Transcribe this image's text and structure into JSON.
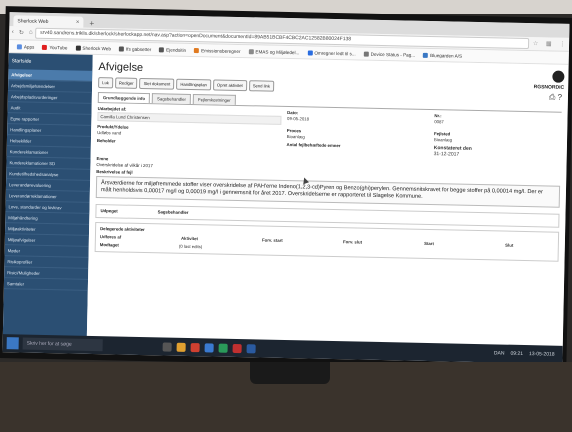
{
  "browser": {
    "tab_title": "Sherlock Web",
    "url": "srv40.sandrens.triklis.dk/sherlock/sherlockapp.net/nav.asp?action=openDocument&documentId=89AB51BCBF4CBC2AC12582B80024F138",
    "bookmarks": [
      {
        "label": "Apps",
        "color": "#5a8de0"
      },
      {
        "label": "YouTube",
        "color": "#e02020"
      },
      {
        "label": "Sherlock Web",
        "color": "#333333"
      },
      {
        "label": "Ifs gabsetter",
        "color": "#555555"
      },
      {
        "label": "Ejendsitin",
        "color": "#555555"
      },
      {
        "label": "Emissionsberegner",
        "color": "#e07a20"
      },
      {
        "label": "EMAS og Miljøledel...",
        "color": "#8a8a8a"
      },
      {
        "label": "Omregner ledt til s...",
        "color": "#2a6de0"
      },
      {
        "label": "Device Status - Pag...",
        "color": "#777777"
      },
      {
        "label": "Bluegarden A/S",
        "color": "#3a78c4"
      }
    ]
  },
  "sidebar": {
    "header": "Startside",
    "items": [
      {
        "label": "Afvigelser",
        "active": true
      },
      {
        "label": "Arbejdsmiljøhændelser",
        "active": false
      },
      {
        "label": "Arbejdspladsvurderinger",
        "active": false
      },
      {
        "label": "Audit",
        "active": false
      },
      {
        "label": "Egne rapporter",
        "active": false
      },
      {
        "label": "Handlingsplaner",
        "active": false
      },
      {
        "label": "Helsekilder",
        "active": false
      },
      {
        "label": "Kundereklamationer",
        "active": false
      },
      {
        "label": "Kundereklamationer SD",
        "active": false
      },
      {
        "label": "Kundetilfredshedsanalyse",
        "active": false
      },
      {
        "label": "Leverandørevaluering",
        "active": false
      },
      {
        "label": "Leverandørreklamationer",
        "active": false
      },
      {
        "label": "Love, standarder og lovkrav",
        "active": false
      },
      {
        "label": "Miljøhåndtering",
        "active": false
      },
      {
        "label": "Miljøaktiviteter",
        "active": false
      },
      {
        "label": "Miljøafvigelser",
        "active": false
      },
      {
        "label": "Møder",
        "active": false
      },
      {
        "label": "Risikoprofiler",
        "active": false
      },
      {
        "label": "Risici/Muligheder",
        "active": false
      },
      {
        "label": "Samtaler",
        "active": false
      }
    ]
  },
  "page": {
    "title": "Afvigelse",
    "logo_text": "RGSNORDIC",
    "buttons": [
      "Luk",
      "Rediger",
      "Slet dokument",
      "Handlingsplan",
      "Opret aktivitet",
      "Send link"
    ],
    "tabs": [
      {
        "label": "Grundlæggende info",
        "active": true
      },
      {
        "label": "Sagsbehandler",
        "active": false
      },
      {
        "label": "Fejlomkostninger",
        "active": false
      }
    ],
    "fields": {
      "udarbejdet_label": "Udarbejdet af:",
      "udarbejdet_value": "Camilla Lund Christensen",
      "dato_label": "Dato:",
      "dato_value": "09-05-2018",
      "nr_label": "Nr.:",
      "nr_value": "0087",
      "produkt_label": "Produkt/Ydelse",
      "produkt_value": "Udløbs vand",
      "proces_label": "Proces",
      "proces_value": "Bioanlæg",
      "fejlsted_label": "Fejlsted",
      "fejlsted_value": "Bioanlæg",
      "beholder_label": "Beholder",
      "antal_label": "Antal fejlbehæftede emner",
      "konst_label": "Konstateret den",
      "konst_value": "31-12-2017",
      "emne_label": "Emne",
      "emne_value": "Overskridelse af vilkår i 2017",
      "beskrivelse_label": "Beskrivelse af fejl",
      "beskrivelse_text": "Årsværdierne for miljøfremmede stoffer viser overskridelse af PAH'erne Indeno(1,2,3-cd)Pyren og Benzo(ghi)perylen. Gennemsnitskravet for begge stoffer på 0,00014 mg/l. Der er målt henholdsvis 0,00017 mg/l og 0,00019 mg/l i gennemsnit for året 2017. Overskridelserne er rapporteret til Slagelse Kommune."
    },
    "section_udpeget": {
      "label": "Udpeget",
      "value": "Sagsbehandler"
    },
    "section_delegerede": {
      "label": "Delegerede aktiviteter",
      "columns": [
        "Udføres af",
        "Aktivitet",
        "Forv. start",
        "Forv. slut",
        "Start",
        "Slut"
      ],
      "row_label": "Modtaget",
      "row_value": "(0 last edits)"
    }
  },
  "taskbar": {
    "search_placeholder": "Skriv her for at søge",
    "tray_lang": "DAN",
    "tray_time": "09:21",
    "tray_date": "13-05-2018"
  }
}
